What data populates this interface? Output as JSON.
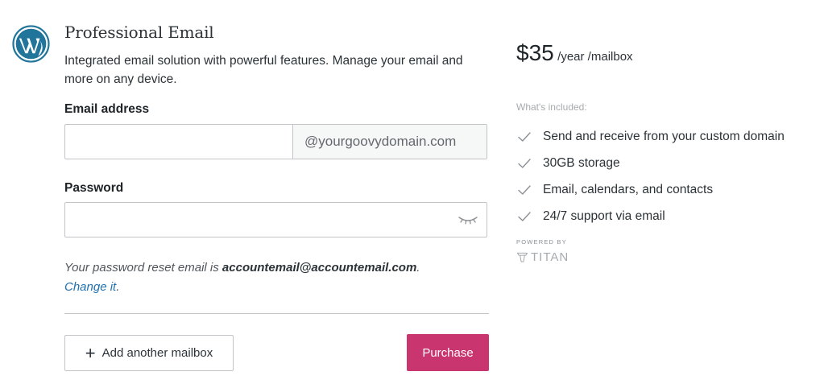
{
  "product": {
    "title": "Professional Email",
    "description": "Integrated email solution with powerful features. Manage your email and more on any device."
  },
  "form": {
    "email_label": "Email address",
    "email_value": "",
    "email_placeholder": "",
    "domain_suffix": "@yourgoovydomain.com",
    "password_label": "Password",
    "password_value": "",
    "password_placeholder": ""
  },
  "notice": {
    "prefix": "Your password reset email is ",
    "email": "accountemail@accountemail.com",
    "period": ".",
    "link": "Change it",
    "suffix": "."
  },
  "actions": {
    "add_mailbox": "Add another mailbox",
    "purchase": "Purchase"
  },
  "pricing": {
    "amount": "$35",
    "unit": "/year /mailbox",
    "included_label": "What's included:",
    "features": [
      "Send and receive from your custom domain",
      "30GB storage",
      "Email, calendars, and contacts",
      "24/7 support via email"
    ]
  },
  "branding": {
    "powered_by": "POWERED BY",
    "provider": "TITAN"
  },
  "colors": {
    "purchase": "#c9356e",
    "link": "#2271b1",
    "wordpress": "#21759b"
  },
  "icons": {
    "logo": "wordpress-logo-icon",
    "eye": "eye-closed-icon",
    "plus": "plus-icon",
    "check": "checkmark-icon",
    "titan": "titan-logo-icon"
  }
}
